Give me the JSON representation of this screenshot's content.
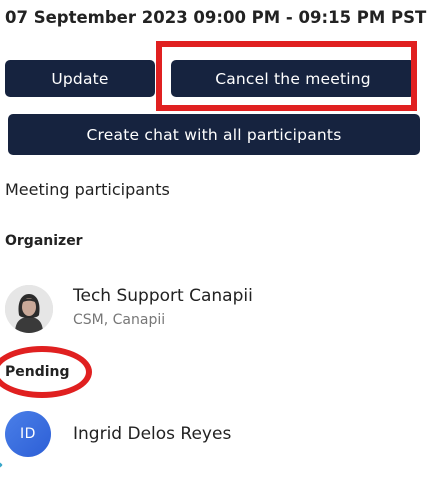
{
  "meeting": {
    "datetime": "07 September 2023 09:00 PM - 09:15 PM PST"
  },
  "actions": {
    "update_label": "Update",
    "cancel_label": "Cancel the meeting",
    "chat_label": "Create chat with all participants"
  },
  "participants": {
    "section_title": "Meeting participants",
    "organizer_label": "Organizer",
    "organizer": {
      "name": "Tech Support Canapii",
      "role": "CSM, Canapii"
    },
    "pending_label": "Pending",
    "pending": [
      {
        "initials": "ID",
        "name": "Ingrid Delos Reyes"
      }
    ]
  },
  "colors": {
    "button_bg": "#16233f",
    "annotation": "#e02020",
    "initials_avatar": "#3a6fe0"
  }
}
